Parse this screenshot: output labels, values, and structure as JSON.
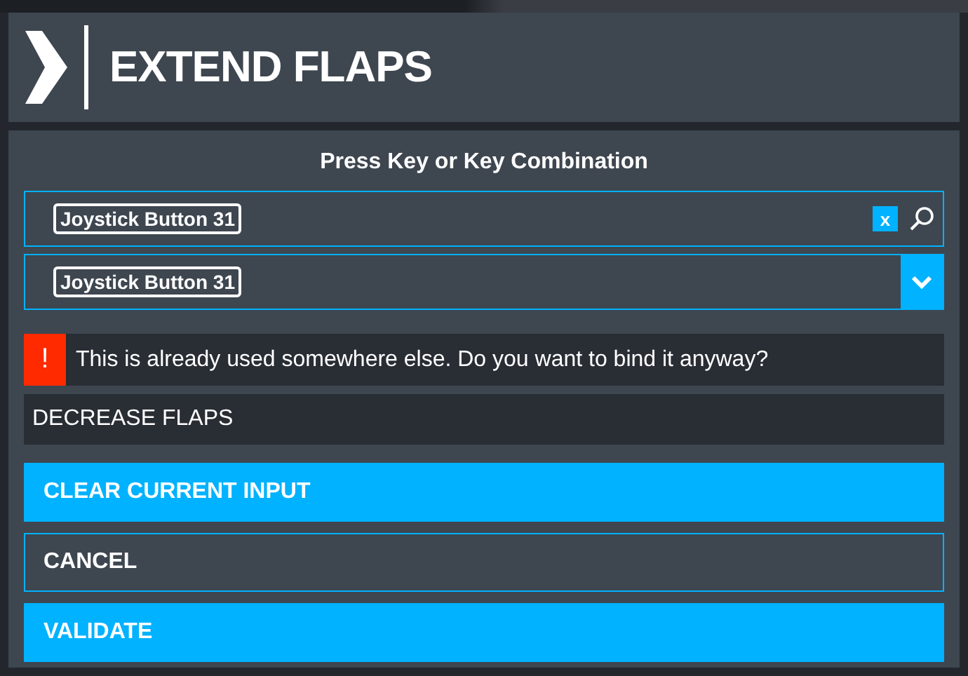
{
  "header": {
    "title": "EXTEND FLAPS"
  },
  "dialog": {
    "prompt": "Press Key or Key Combination",
    "search_field": {
      "value": "Joystick Button 31",
      "clear_label": "x"
    },
    "dropdown": {
      "value": "Joystick Button 31"
    },
    "warning": {
      "icon": "!",
      "message": "This is already used somewhere else. Do you want to bind it anyway?"
    },
    "conflict": "DECREASE FLAPS",
    "buttons": [
      {
        "label": "CLEAR CURRENT INPUT",
        "kind": "filled"
      },
      {
        "label": "CANCEL",
        "kind": "outlined"
      },
      {
        "label": "VALIDATE",
        "kind": "filled"
      }
    ]
  }
}
